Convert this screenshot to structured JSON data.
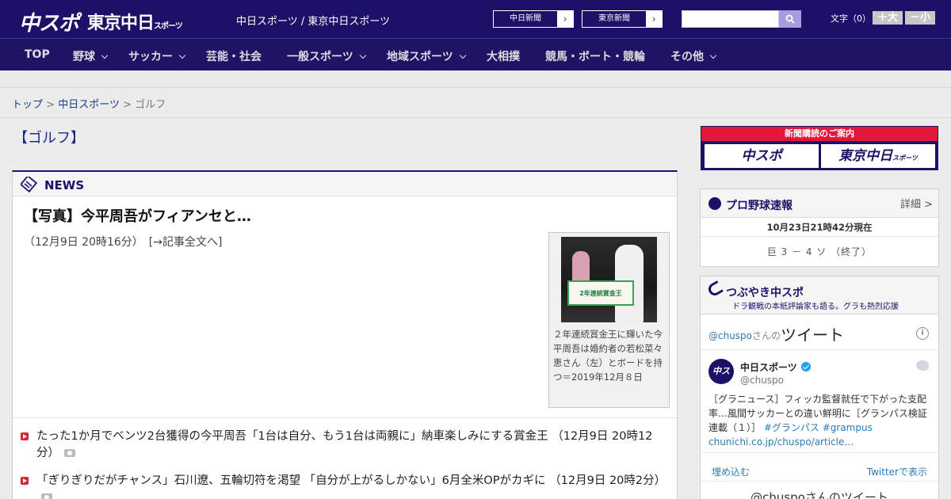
{
  "header": {
    "logo_chuspo": "中スポ",
    "logo_tokyo": "東京中日",
    "logo_tokyo_small": "スポーツ",
    "site_name": "中日スポーツ / 東京中日スポーツ",
    "links": [
      {
        "label": "中日新聞",
        "arrow": "›"
      },
      {
        "label": "東京新聞",
        "arrow": "›"
      }
    ],
    "search_placeholder": "",
    "font_label": "文字（0）",
    "font_larger": "＋大",
    "font_smaller": "－小"
  },
  "nav": {
    "items": [
      {
        "label": "TOP",
        "dropdown": false
      },
      {
        "label": "野球",
        "dropdown": true
      },
      {
        "label": "サッカー",
        "dropdown": true
      },
      {
        "label": "芸能・社会",
        "dropdown": false
      },
      {
        "label": "一般スポーツ",
        "dropdown": true
      },
      {
        "label": "地域スポーツ",
        "dropdown": true
      },
      {
        "label": "大相撲",
        "dropdown": false
      },
      {
        "label": "競馬・ボート・競輪",
        "dropdown": false
      },
      {
        "label": "その他",
        "dropdown": true
      }
    ]
  },
  "breadcrumb": {
    "top": "トップ",
    "sep": ">",
    "section": "中日スポーツ",
    "current": "ゴルフ"
  },
  "page_title": "【ゴルフ】",
  "news": {
    "heading": "NEWS",
    "article": {
      "title": "【写真】今平周吾がフィアンセと…",
      "meta": "（12月9日 20時16分）　[→記事全文へ]",
      "photo_board_text": "2年連続賞金王",
      "photo_caption": "２年連続賞金王に輝いた今平周吾は婚約者の若松菜々恵さん（左）とボードを持つ＝2019年12月８日"
    },
    "list": [
      {
        "text": "たった1か月でベンツ2台獲得の今平周吾「1台は自分、もう1台は両親に」納車楽しみにする賞金王 （12月9日 20時12分）"
      },
      {
        "text": "「ぎりぎりだがチャンス」石川遼、五輪切符を渇望 「自分が上がるしかない」6月全米OPがカギに （12月9日 20時2分）"
      }
    ]
  },
  "sidebar": {
    "promo": {
      "header": "新聞購読のご案内",
      "left": "中スポ",
      "right": "東京中日",
      "right_small": "スポーツ"
    },
    "baseball": {
      "title": "プロ野球速報",
      "more": "詳細 >",
      "time": "10月23日21時42分現在",
      "score": "巨 3 － 4 ソ （終了）"
    },
    "tweets": {
      "title": "つぶやき中スポ",
      "subtitle": "ドラ観戦の本紙評論家も語る。グラも熱烈応援",
      "handle": "@chuspo",
      "handle_suffix": "さんの",
      "tweets_word": "ツイート",
      "name": "中日スポーツ",
      "user": "@chuspo",
      "avatar_text": "中スポ",
      "text_main": "［グラニュース］フィッカ監督就任で下がった支配率…風間サッカーとの違い鮮明に［グランパス検証連載（１）］",
      "text_tags": "#グランパス #grampus",
      "text_link": "chunichi.co.jp/chuspo/article…",
      "embed": "埋め込む",
      "view": "Twitterで表示",
      "footer": "@chuspoさんのツイート"
    }
  },
  "colors": {
    "brand_navy": "#1b1169",
    "accent_red": "#e3173b",
    "link_blue": "#2b7bb9"
  }
}
